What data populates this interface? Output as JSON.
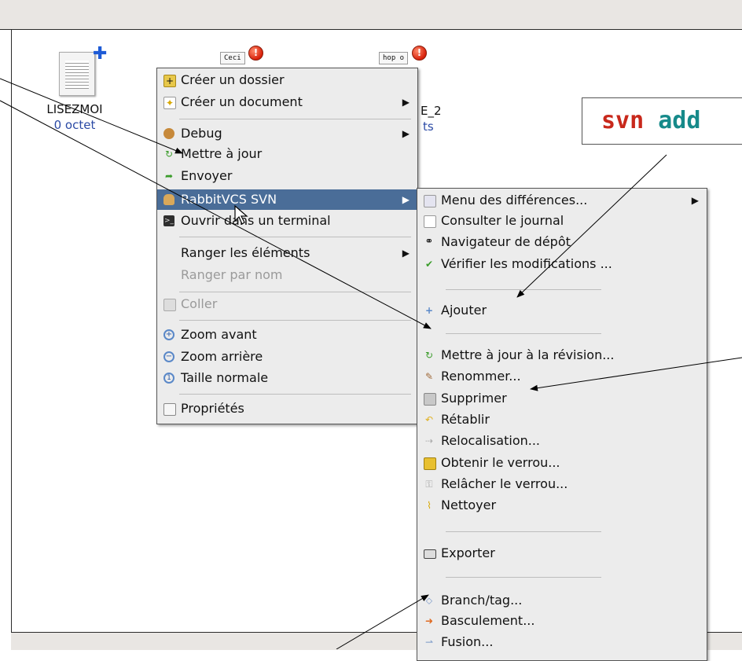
{
  "files": [
    {
      "name": "LISEZMOI",
      "size": "0 octet"
    },
    {
      "thumb_text": "Ceci"
    },
    {
      "thumb_text": "hop o",
      "name_partial": "E_2",
      "size_partial": "ts"
    }
  ],
  "context_menu": {
    "items": [
      {
        "label": "Créer un dossier",
        "icon": "folder-new-icon",
        "submenu": false
      },
      {
        "label": "Créer un document",
        "icon": "document-new-icon",
        "submenu": true
      },
      {
        "label": "Debug",
        "icon": "monkey-icon",
        "submenu": true
      },
      {
        "label": "Mettre à jour",
        "icon": "update-icon",
        "submenu": false
      },
      {
        "label": "Envoyer",
        "icon": "commit-icon",
        "submenu": false
      },
      {
        "label": "RabbitVCS SVN",
        "icon": "rabbitvcs-icon",
        "submenu": true,
        "highlighted": true
      },
      {
        "label": "Ouvrir dans un terminal",
        "icon": "terminal-icon",
        "submenu": false
      },
      {
        "label": "Ranger les éléments",
        "submenu": true
      },
      {
        "label": "Ranger par nom",
        "disabled": true
      },
      {
        "label": "Coller",
        "icon": "paste-icon",
        "disabled": true
      },
      {
        "label": "Zoom avant",
        "icon": "zoom-in-icon"
      },
      {
        "label": "Zoom arrière",
        "icon": "zoom-out-icon"
      },
      {
        "label": "Taille normale",
        "icon": "zoom-normal-icon"
      },
      {
        "label": "Propriétés",
        "icon": "properties-icon"
      }
    ]
  },
  "svn_submenu": {
    "items": [
      {
        "label": "Menu des différences...",
        "icon": "diff-icon",
        "submenu": true
      },
      {
        "label": "Consulter le journal",
        "icon": "log-icon"
      },
      {
        "label": "Navigateur de dépôt",
        "icon": "binoculars-icon"
      },
      {
        "label": "Vérifier les modifications ...",
        "icon": "check-icon"
      },
      {
        "label": "Ajouter",
        "icon": "add-icon"
      },
      {
        "label": "Mettre à jour à la révision...",
        "icon": "update-icon"
      },
      {
        "label": "Renommer...",
        "icon": "rename-icon"
      },
      {
        "label": "Supprimer",
        "icon": "trash-icon"
      },
      {
        "label": "Rétablir",
        "icon": "revert-icon"
      },
      {
        "label": "Relocalisation...",
        "icon": "relocate-icon"
      },
      {
        "label": "Obtenir le verrou...",
        "icon": "lock-icon"
      },
      {
        "label": "Relâcher le verrou...",
        "icon": "unlock-icon"
      },
      {
        "label": "Nettoyer",
        "icon": "broom-icon"
      },
      {
        "label": "Exporter",
        "icon": "export-icon"
      },
      {
        "label": "Branch/tag...",
        "icon": "branch-icon"
      },
      {
        "label": "Basculement...",
        "icon": "switch-icon"
      },
      {
        "label": "Fusion...",
        "icon": "merge-icon"
      }
    ]
  },
  "callout": {
    "svn": "svn",
    "cmd": "add"
  },
  "colors": {
    "highlight": "#4a6d98",
    "svn_text": "#c8281b",
    "cmd_text": "#168a8a",
    "size_text": "#2b4aa5"
  }
}
